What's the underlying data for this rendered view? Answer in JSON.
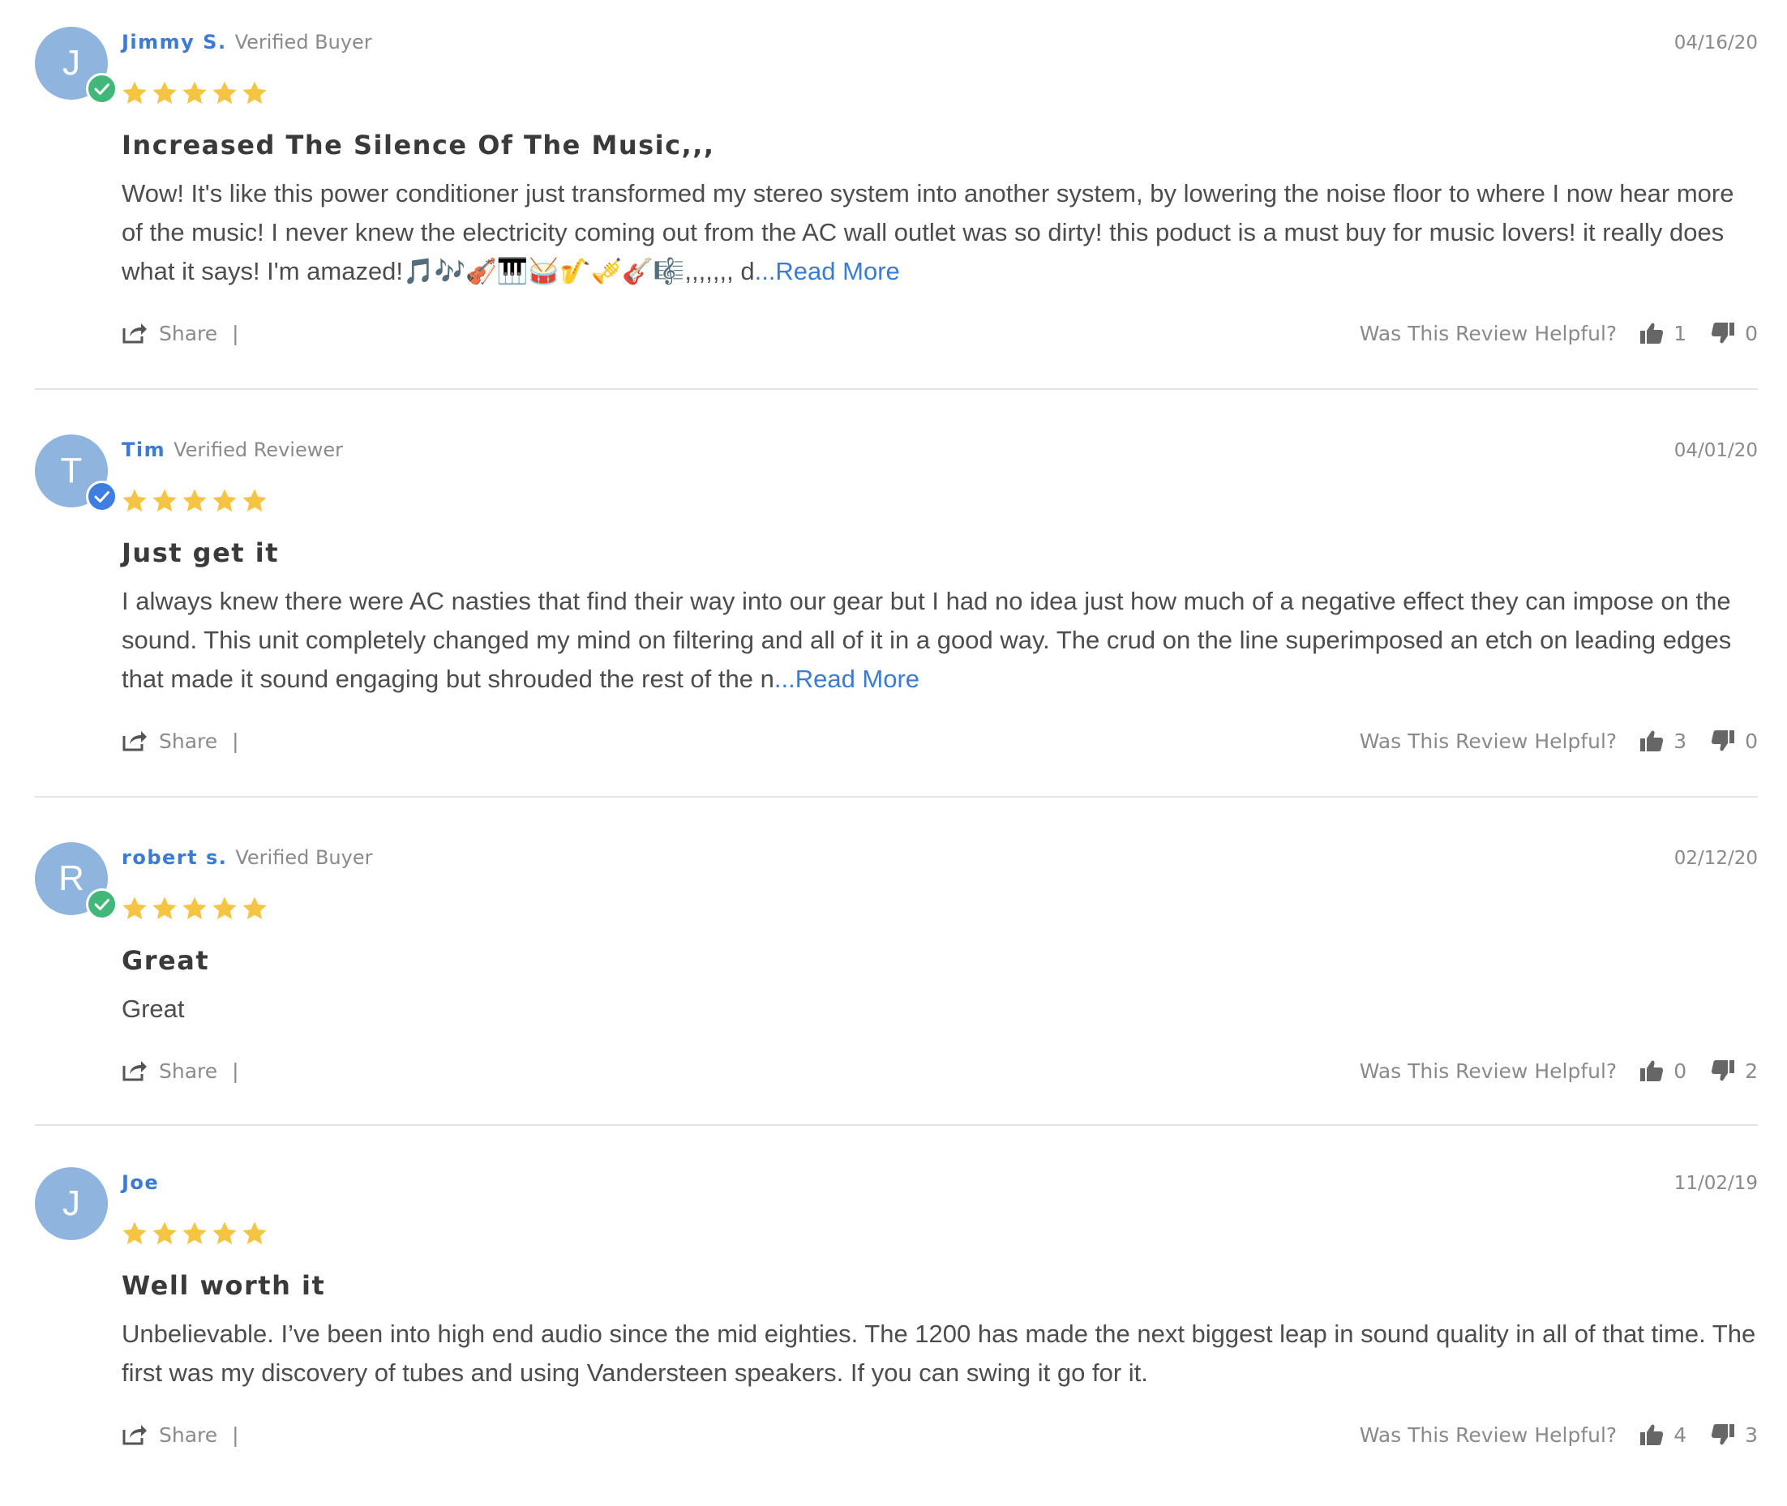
{
  "labels": {
    "share": "Share",
    "helpful_question": "Was This Review Helpful?",
    "read_more": "...Read More"
  },
  "colors": {
    "author_name": "#3a7bd5",
    "avatar_bg": "#8fb4dd",
    "verified_buyer_badge": "#41b879",
    "verified_reviewer_badge": "#3f7ee1",
    "star": "#f6c443"
  },
  "icons": {
    "share": "share-icon",
    "thumbs_up": "thumbs-up-icon",
    "thumbs_down": "thumbs-down-icon",
    "star": "star-icon",
    "verified": "check-icon"
  },
  "reviews": [
    {
      "initial": "J",
      "author": "Jimmy S.",
      "status": "Verified Buyer",
      "badge": "buyer",
      "date": "04/16/20",
      "rating": 5,
      "title": "Increased The Silence Of The Music,,,",
      "body": "Wow! It's like this power conditioner just transformed my stereo system into another system, by lowering the noise floor to where I now hear more of the music! I never knew the electricity coming out from the AC wall outlet was so dirty! this poduct is a must buy for music lovers! it really does what it says! I'm amazed!🎵🎶🎻🎹🥁🎷🎺🎸🎼,,,,,,, d",
      "read_more": true,
      "helpful_yes": "1",
      "helpful_no": "0"
    },
    {
      "initial": "T",
      "author": "Tim",
      "status": "Verified Reviewer",
      "badge": "reviewer",
      "date": "04/01/20",
      "rating": 5,
      "title": "Just get it",
      "body": "I always knew there were AC nasties that find their way into our gear but I had no idea just how much of a negative effect they can impose on the sound. This unit completely changed my mind on filtering and all of it in a good way. The crud on the line superimposed an etch on leading edges that made it sound engaging but shrouded the rest of the n",
      "read_more": true,
      "helpful_yes": "3",
      "helpful_no": "0"
    },
    {
      "initial": "R",
      "author": "robert s.",
      "status": "Verified Buyer",
      "badge": "buyer",
      "date": "02/12/20",
      "rating": 5,
      "title": "Great",
      "body": "Great",
      "read_more": false,
      "helpful_yes": "0",
      "helpful_no": "2"
    },
    {
      "initial": "J",
      "author": "Joe",
      "status": "",
      "badge": "",
      "date": "11/02/19",
      "rating": 5,
      "title": "Well worth it",
      "body": "Unbelievable. I’ve been into high end audio since the mid eighties. The 1200 has made the next biggest leap in sound quality in all of that time. The first was my discovery of tubes and using Vandersteen speakers. If you can swing it go for it.",
      "read_more": false,
      "helpful_yes": "4",
      "helpful_no": "3"
    }
  ]
}
